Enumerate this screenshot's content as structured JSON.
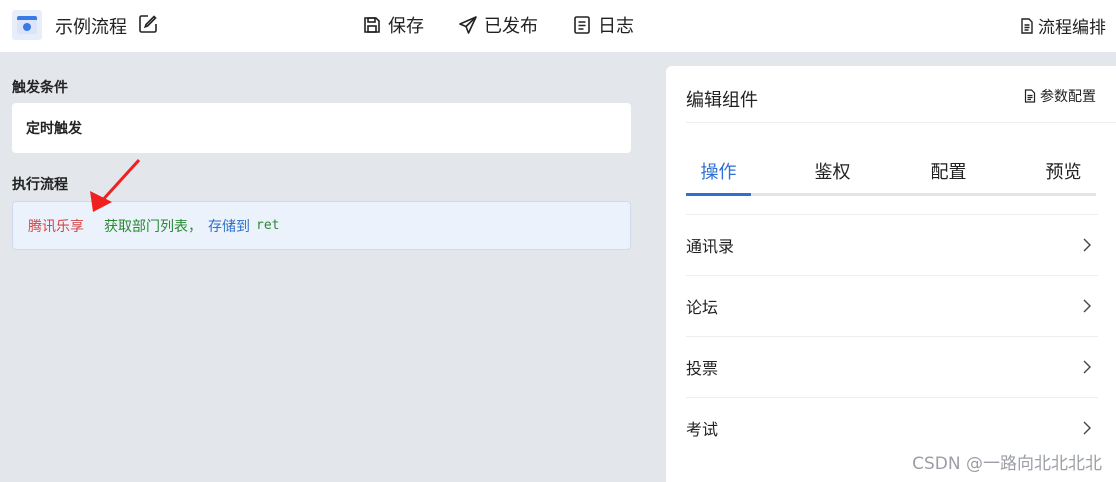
{
  "header": {
    "flow_title": "示例流程",
    "actions": {
      "save": "保存",
      "publish": "已发布",
      "log": "日志"
    },
    "flow_arrange": "流程编排"
  },
  "left": {
    "trigger_label": "触发条件",
    "trigger_value": "定时触发",
    "exec_label": "执行流程",
    "step": {
      "app": "腾讯乐享",
      "op": "获取部门列表",
      "comma": "，",
      "store": "存储到",
      "var": "ret"
    }
  },
  "right": {
    "title": "编辑组件",
    "param_config": "参数配置",
    "tabs": [
      "操作",
      "鉴权",
      "配置",
      "预览"
    ],
    "active_tab": "操作",
    "items": [
      "通讯录",
      "论坛",
      "投票",
      "考试"
    ]
  },
  "watermark": "CSDN @一路向北北北北",
  "colors": {
    "accent": "#2f6fd6",
    "app_name": "#d64545",
    "operation": "#2a8a32",
    "store": "#2f72c8",
    "annotation_arrow": "#f02020"
  }
}
